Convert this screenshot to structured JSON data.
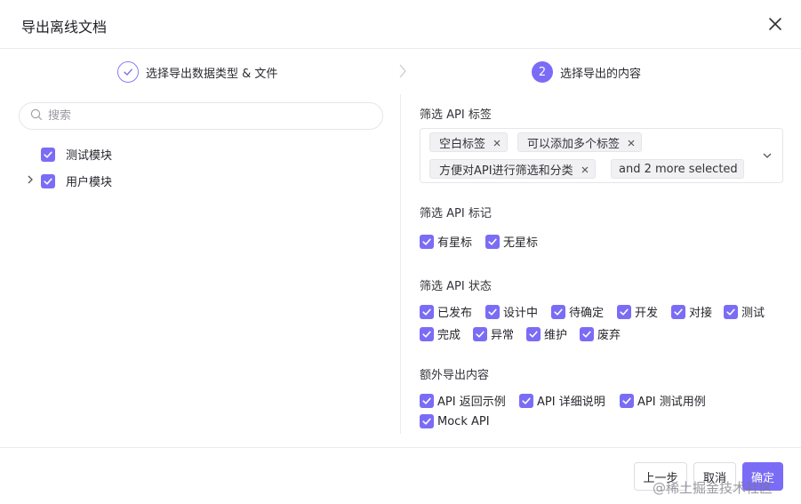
{
  "dialog": {
    "title": "导出离线文档"
  },
  "steps": [
    {
      "label": "选择导出数据类型 & 文件",
      "status": "done"
    },
    {
      "number": "2",
      "label": "选择导出的内容",
      "status": "active"
    }
  ],
  "left": {
    "search_placeholder": "搜索",
    "tree": [
      {
        "label": "测试模块",
        "checked": true
      },
      {
        "label": "用户模块",
        "checked": true,
        "expandable": true
      }
    ]
  },
  "right": {
    "tags_section": {
      "title": "筛选 API 标签",
      "tags": [
        "空白标签",
        "可以添加多个标签",
        "方便对API进行筛选和分类"
      ],
      "more": "and 2 more selected"
    },
    "marks_section": {
      "title": "筛选 API 标记",
      "options": [
        "有星标",
        "无星标"
      ]
    },
    "status_section": {
      "title": "筛选 API 状态",
      "options": [
        "已发布",
        "设计中",
        "待确定",
        "开发",
        "对接",
        "测试",
        "完成",
        "异常",
        "维护",
        "废弃"
      ]
    },
    "extra_section": {
      "title": "额外导出内容",
      "options": [
        "API 返回示例",
        "API 详细说明",
        "API 测试用例",
        "Mock API"
      ]
    }
  },
  "footer": {
    "prev": "上一步",
    "cancel": "取消",
    "ok": "确定"
  },
  "watermark": "@稀土掘金技术社区",
  "colors": {
    "accent": "#7b6cf6",
    "border": "#ececef"
  }
}
